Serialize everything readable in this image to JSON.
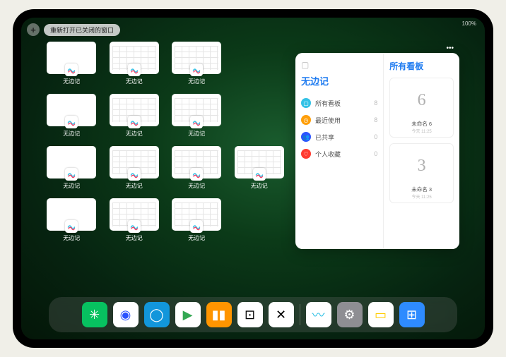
{
  "status": "100%",
  "topbar": {
    "plus": "+",
    "reopen_label": "重新打开已关闭的窗口"
  },
  "app_name": "无边记",
  "windows": [
    {
      "type": "blank"
    },
    {
      "type": "grid"
    },
    {
      "type": "grid"
    },
    {
      "type": "empty"
    },
    {
      "type": "blank"
    },
    {
      "type": "grid"
    },
    {
      "type": "grid"
    },
    {
      "type": "empty"
    },
    {
      "type": "blank"
    },
    {
      "type": "grid"
    },
    {
      "type": "grid"
    },
    {
      "type": "grid"
    },
    {
      "type": "blank"
    },
    {
      "type": "grid"
    },
    {
      "type": "grid"
    },
    {
      "type": "empty"
    }
  ],
  "panel": {
    "title": "无边记",
    "items": [
      {
        "icon": "c1",
        "glyph": "▢",
        "label": "所有看板",
        "count": "8"
      },
      {
        "icon": "c2",
        "glyph": "◷",
        "label": "最近使用",
        "count": "8"
      },
      {
        "icon": "c3",
        "glyph": "👥",
        "label": "已共享",
        "count": "0"
      },
      {
        "icon": "c4",
        "glyph": "♡",
        "label": "个人收藏",
        "count": "0"
      }
    ],
    "right_title": "所有看板",
    "boards": [
      {
        "sketch": "6",
        "name": "未命名 6",
        "time": "今天 11:25"
      },
      {
        "sketch": "3",
        "name": "未命名 3",
        "time": "今天 11:25"
      }
    ]
  },
  "dock": [
    {
      "name": "wechat",
      "bg": "#07c160",
      "glyph": "✳"
    },
    {
      "name": "quark",
      "bg": "#fff",
      "glyph": "◉",
      "fg": "#2952ff"
    },
    {
      "name": "qqbrowser",
      "bg": "#1296db",
      "glyph": "◯"
    },
    {
      "name": "play",
      "bg": "#fff",
      "glyph": "▶",
      "fg": "#34a853"
    },
    {
      "name": "books",
      "bg": "#ff9500",
      "glyph": "▮▮"
    },
    {
      "name": "dice",
      "bg": "#fff",
      "glyph": "⊡",
      "fg": "#000"
    },
    {
      "name": "connect",
      "bg": "#fff",
      "glyph": "✕",
      "fg": "#000"
    }
  ],
  "dock_right": [
    {
      "name": "freeform",
      "bg": "#fff",
      "glyph": "〰",
      "fg": "#35c2e6"
    },
    {
      "name": "settings",
      "bg": "#8e8e93",
      "glyph": "⚙"
    },
    {
      "name": "notes",
      "bg": "#fff",
      "glyph": "▭",
      "fg": "#ffcc00"
    },
    {
      "name": "apps",
      "bg": "#2e8bff",
      "glyph": "⊞"
    }
  ]
}
